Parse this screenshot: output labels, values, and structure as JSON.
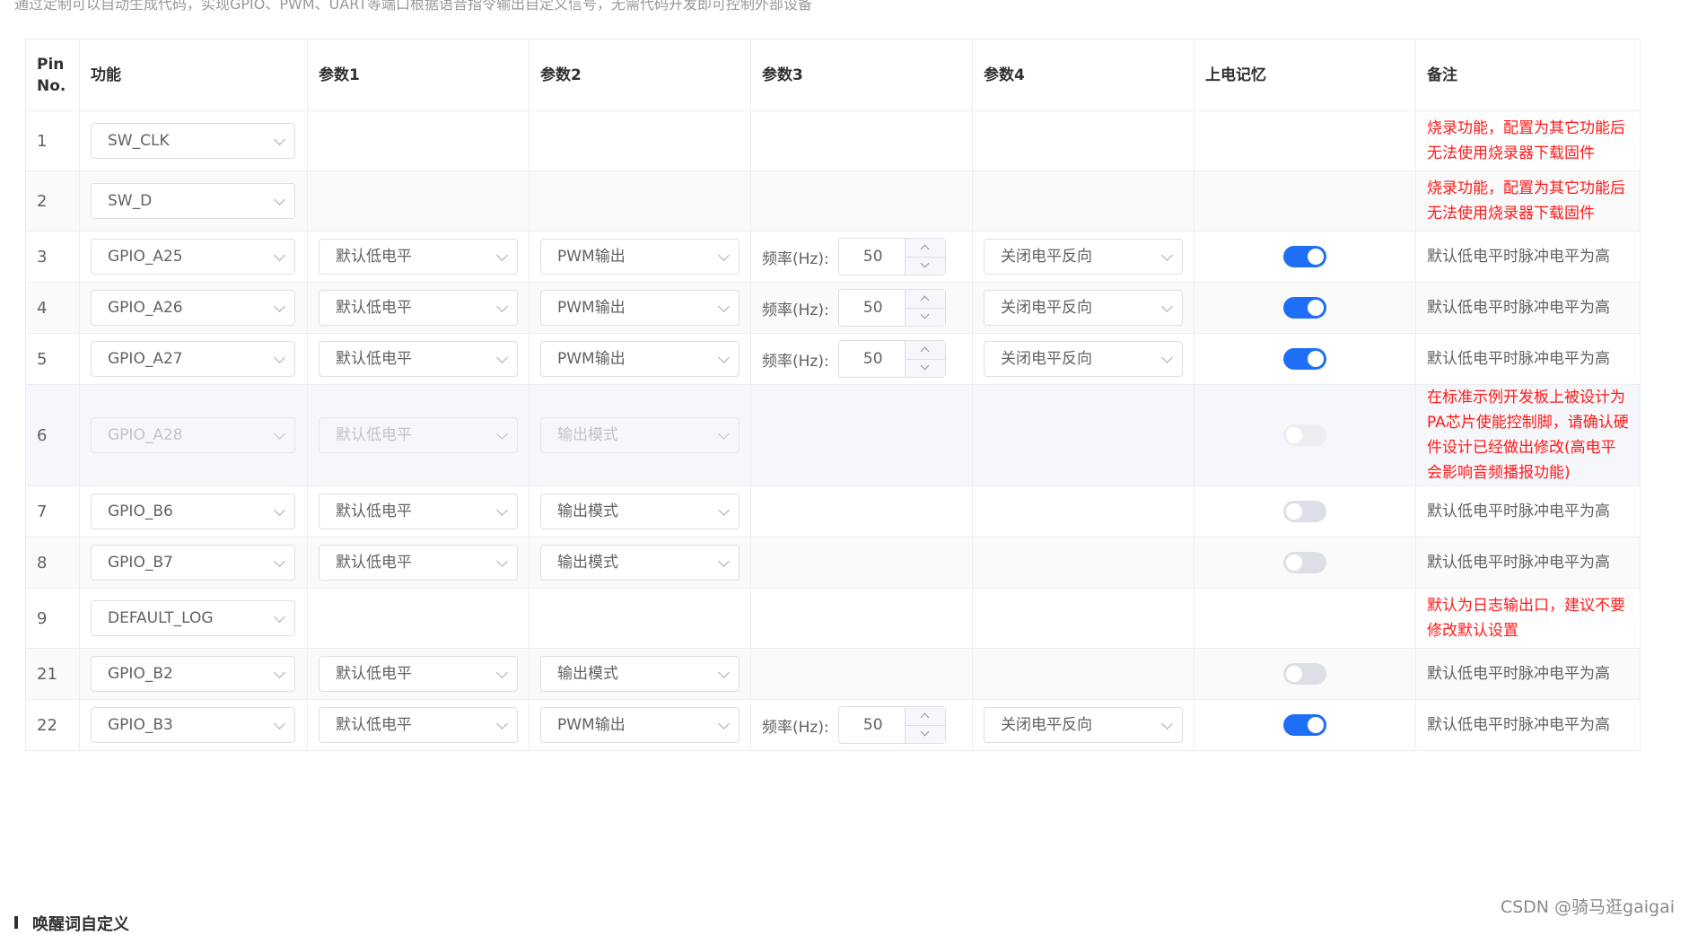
{
  "description": "通过定制可以自动生成代码，实现GPIO、PWM、UART等端口根据语音指令输出自定义信号，无需代码开发即可控制外部设备",
  "columns": [
    "Pin No.",
    "功能",
    "参数1",
    "参数2",
    "参数3",
    "参数4",
    "上电记忆",
    "备注"
  ],
  "colors": {
    "accent": "#1e6ff5",
    "warning_red": "#ff1a1a"
  },
  "rows": [
    {
      "pin": "1",
      "function": "SW_CLK",
      "note": "烧录功能，配置为其它功能后无法使用烧录器下载固件",
      "note_red": true
    },
    {
      "pin": "2",
      "function": "SW_D",
      "note": "烧录功能，配置为其它功能后无法使用烧录器下载固件",
      "note_red": true
    },
    {
      "pin": "3",
      "function": "GPIO_A25",
      "param1": "默认低电平",
      "param2": "PWM输出",
      "freq_label": "频率(Hz):",
      "freq_value": "50",
      "param4": "关闭电平反向",
      "power_memory": true,
      "note": "默认低电平时脉冲电平为高"
    },
    {
      "pin": "4",
      "function": "GPIO_A26",
      "param1": "默认低电平",
      "param2": "PWM输出",
      "freq_label": "频率(Hz):",
      "freq_value": "50",
      "param4": "关闭电平反向",
      "power_memory": true,
      "note": "默认低电平时脉冲电平为高"
    },
    {
      "pin": "5",
      "function": "GPIO_A27",
      "param1": "默认低电平",
      "param2": "PWM输出",
      "freq_label": "频率(Hz):",
      "freq_value": "50",
      "param4": "关闭电平反向",
      "power_memory": true,
      "note": "默认低电平时脉冲电平为高"
    },
    {
      "pin": "6",
      "function": "GPIO_A28",
      "param1": "默认低电平",
      "param2": "输出模式",
      "power_memory": false,
      "disabled": true,
      "note": "在标准示例开发板上被设计为PA芯片使能控制脚，请确认硬件设计已经做出修改(高电平会影响音频播报功能)",
      "note_red": true
    },
    {
      "pin": "7",
      "function": "GPIO_B6",
      "param1": "默认低电平",
      "param2": "输出模式",
      "power_memory": false,
      "note": "默认低电平时脉冲电平为高"
    },
    {
      "pin": "8",
      "function": "GPIO_B7",
      "param1": "默认低电平",
      "param2": "输出模式",
      "power_memory": false,
      "note": "默认低电平时脉冲电平为高"
    },
    {
      "pin": "9",
      "function": "DEFAULT_LOG",
      "note": "默认为日志输出口，建议不要修改默认设置",
      "note_red": true
    },
    {
      "pin": "21",
      "function": "GPIO_B2",
      "param1": "默认低电平",
      "param2": "输出模式",
      "power_memory": false,
      "note": "默认低电平时脉冲电平为高"
    },
    {
      "pin": "22",
      "function": "GPIO_B3",
      "param1": "默认低电平",
      "param2": "PWM输出",
      "freq_label": "频率(Hz):",
      "freq_value": "50",
      "param4": "关闭电平反向",
      "power_memory": true,
      "note": "默认低电平时脉冲电平为高"
    }
  ],
  "section_title": "唤醒词自定义",
  "watermark": "CSDN @骑马逛gaigai"
}
